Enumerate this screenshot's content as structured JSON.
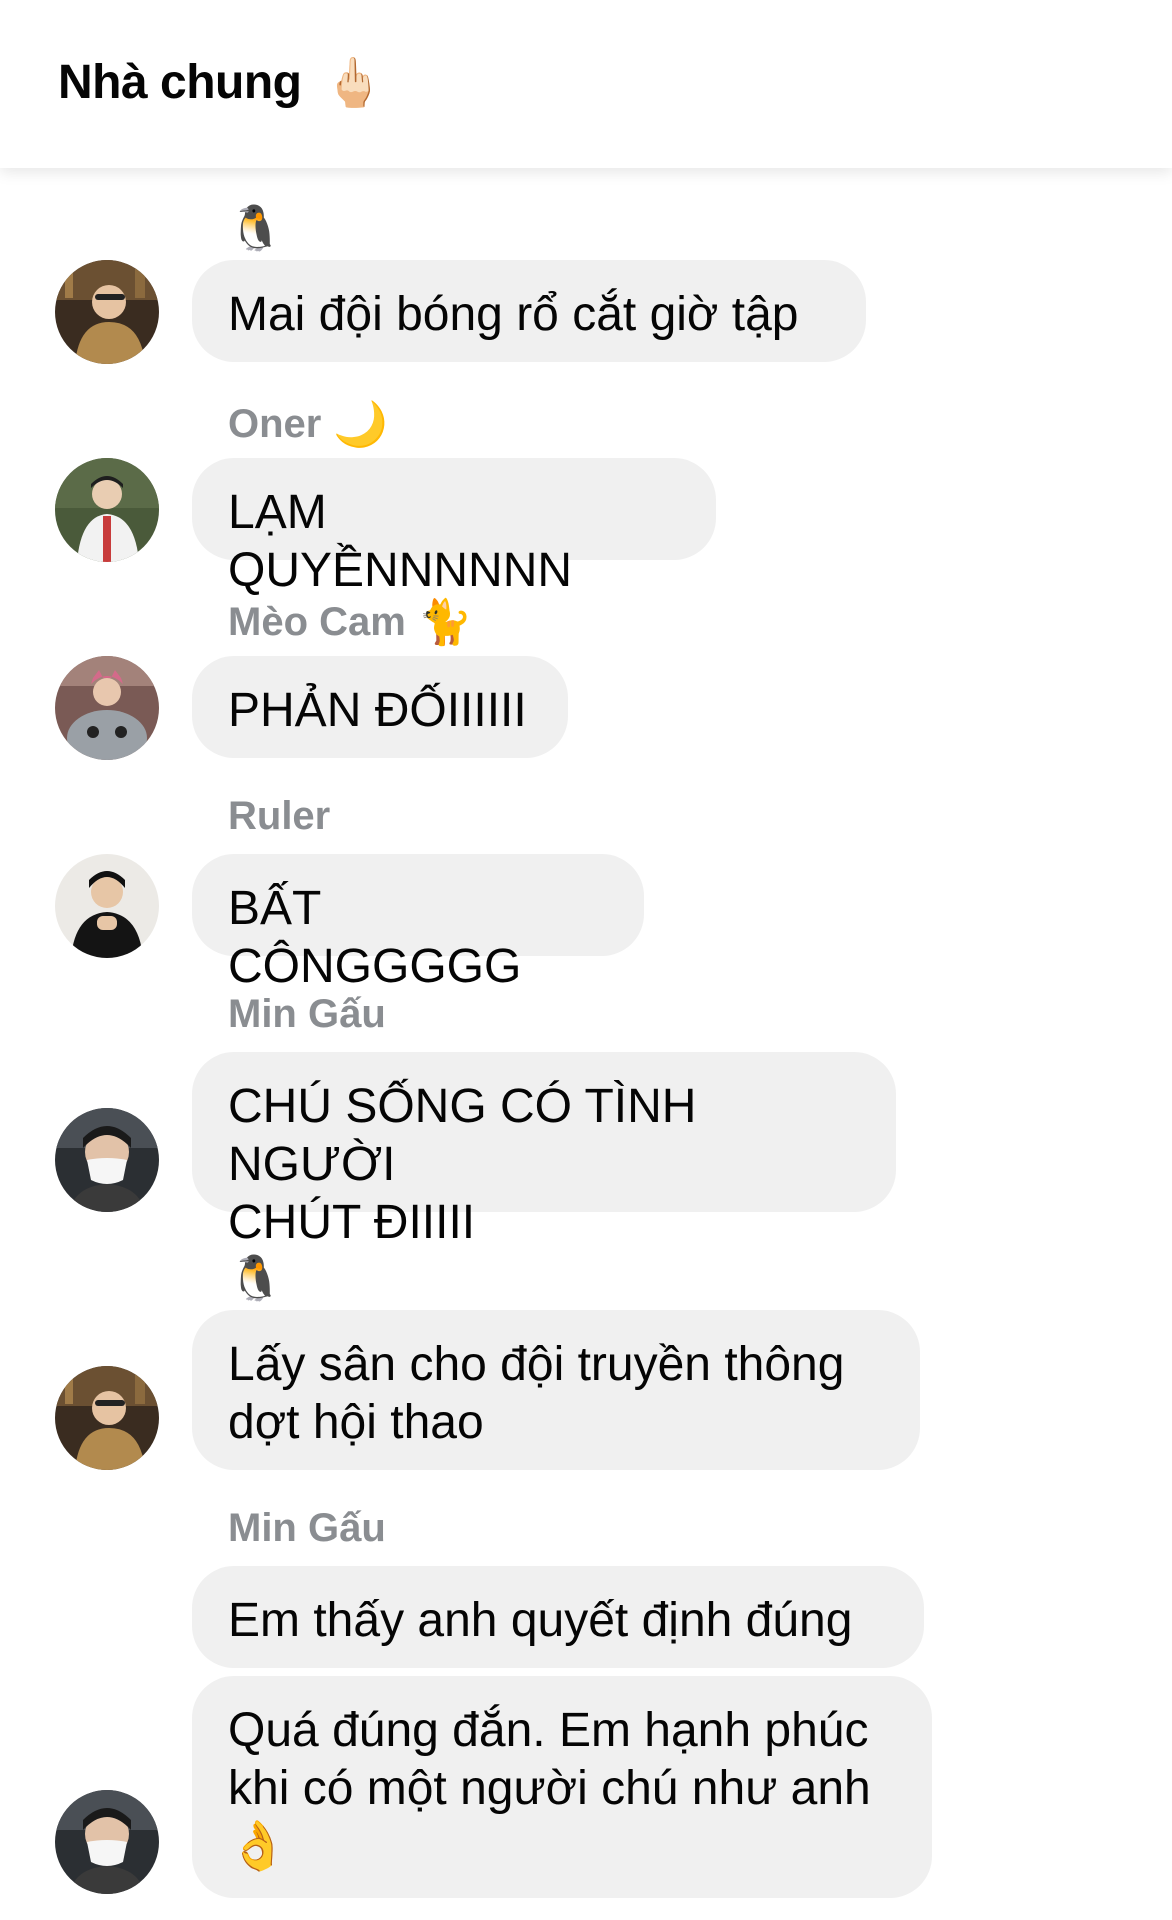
{
  "header": {
    "title": "Nhà chung",
    "emoji": "🖕🏻"
  },
  "messages": [
    {
      "sender": "",
      "sender_emoji": "🐧",
      "text": "Mai đội bóng rổ cắt giờ tập"
    },
    {
      "sender": "Oner",
      "sender_emoji": "🌙",
      "text": "LẠM QUYỀNNNNNN"
    },
    {
      "sender": "Mèo Cam",
      "sender_emoji": "🐈",
      "text": "PHẢN ĐỐIIIIII"
    },
    {
      "sender": "Ruler",
      "sender_emoji": "",
      "text": "BẤT CÔNGGGGG"
    },
    {
      "sender": "Min Gấu",
      "sender_emoji": "",
      "text": "CHÚ SỐNG CÓ TÌNH NGƯỜI\nCHÚT ĐIIIII"
    },
    {
      "sender": "",
      "sender_emoji": "🐧",
      "text": "Lấy sân cho đội truyền thông\ndợt hội thao"
    },
    {
      "sender": "Min Gấu",
      "sender_emoji": "",
      "text": "Em thấy anh quyết định đúng"
    },
    {
      "sender": "",
      "sender_emoji": "",
      "text": "Quá đúng đắn. Em hạnh phúc\nkhi có một người chú như anh\n👌"
    }
  ]
}
